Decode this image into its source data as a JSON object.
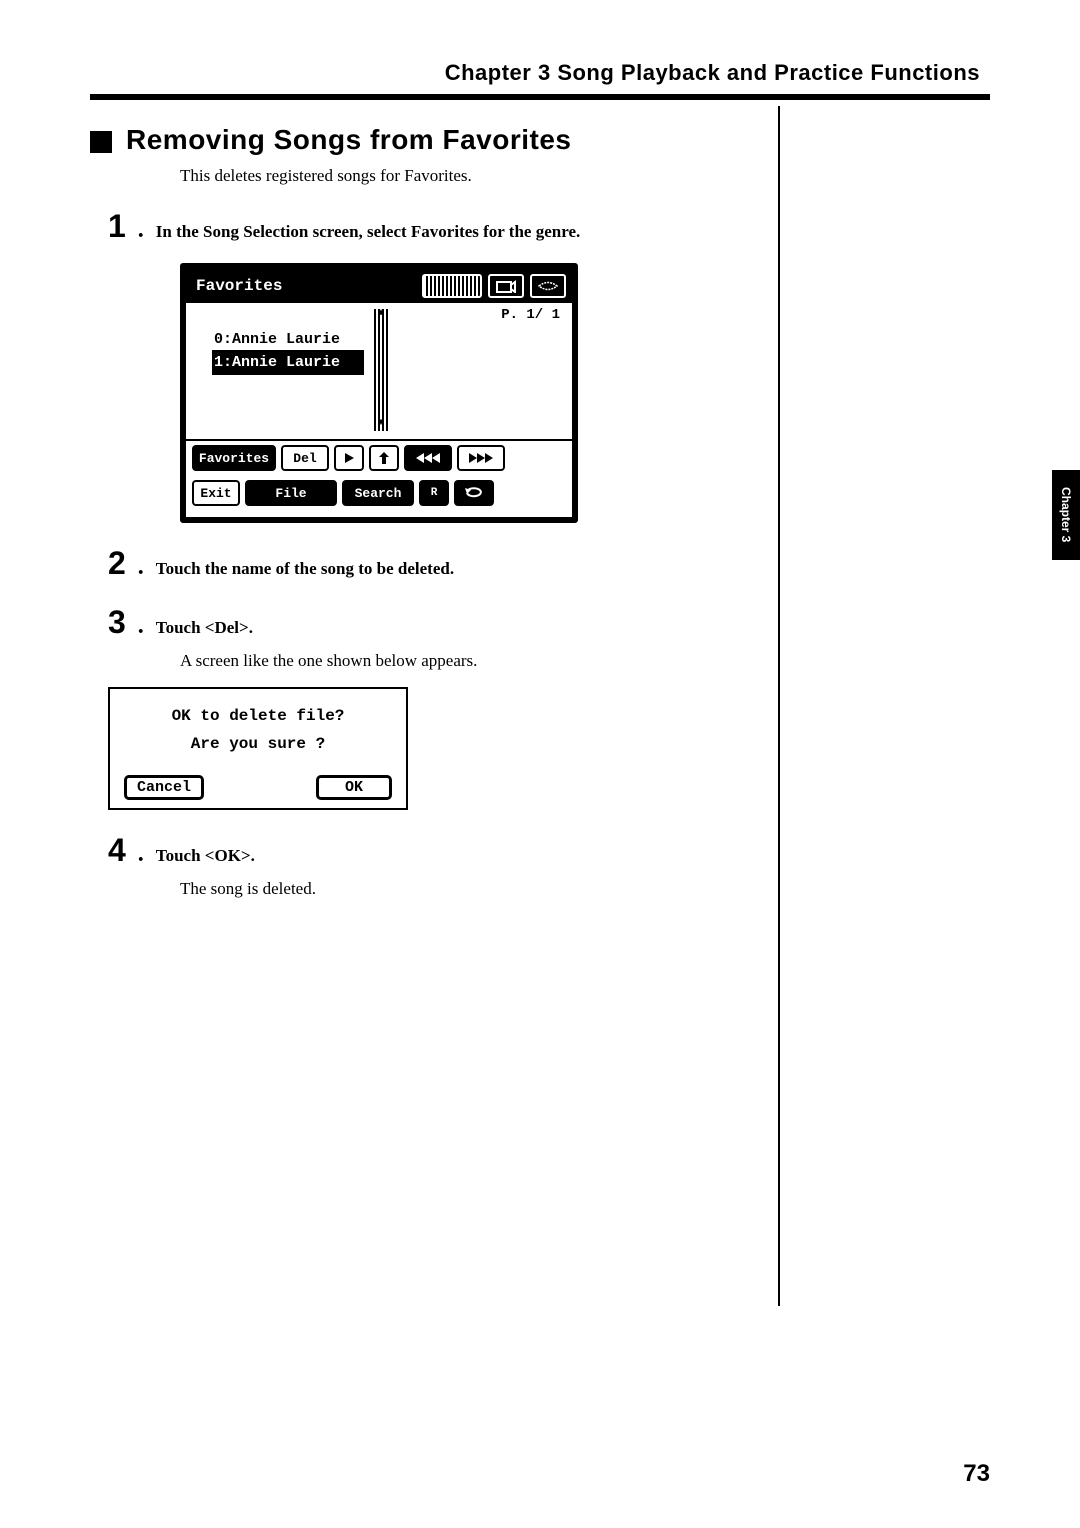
{
  "chapter_header": "Chapter 3 Song Playback and Practice Functions",
  "section": {
    "title": "Removing Songs from Favorites",
    "intro": "This deletes registered songs for Favorites."
  },
  "steps": {
    "s1": {
      "num": "1",
      "dot": ".",
      "text": "In the Song Selection screen, select Favorites for the genre."
    },
    "s2": {
      "num": "2",
      "dot": ".",
      "text": "Touch the name of the song to be deleted."
    },
    "s3": {
      "num": "3",
      "dot": ".",
      "text": "Touch <Del>.",
      "sub": "A screen like the one shown below appears."
    },
    "s4": {
      "num": "4",
      "dot": ".",
      "text": "Touch <OK>.",
      "sub": "The song is deleted."
    }
  },
  "lcd1": {
    "title": "Favorites",
    "page": "P. 1/ 1",
    "song0": "0:Annie Laurie",
    "song1": "1:Annie Laurie",
    "row1": {
      "fav": "Favorites",
      "del": "Del"
    },
    "row2": {
      "exit": "Exit",
      "file": "File",
      "search": "Search",
      "rnd": "R"
    }
  },
  "dialog": {
    "title": "OK to delete file?",
    "msg": "Are you sure ?",
    "cancel": "Cancel",
    "ok": "OK"
  },
  "side_tab": "Chapter 3",
  "page_num": "73"
}
